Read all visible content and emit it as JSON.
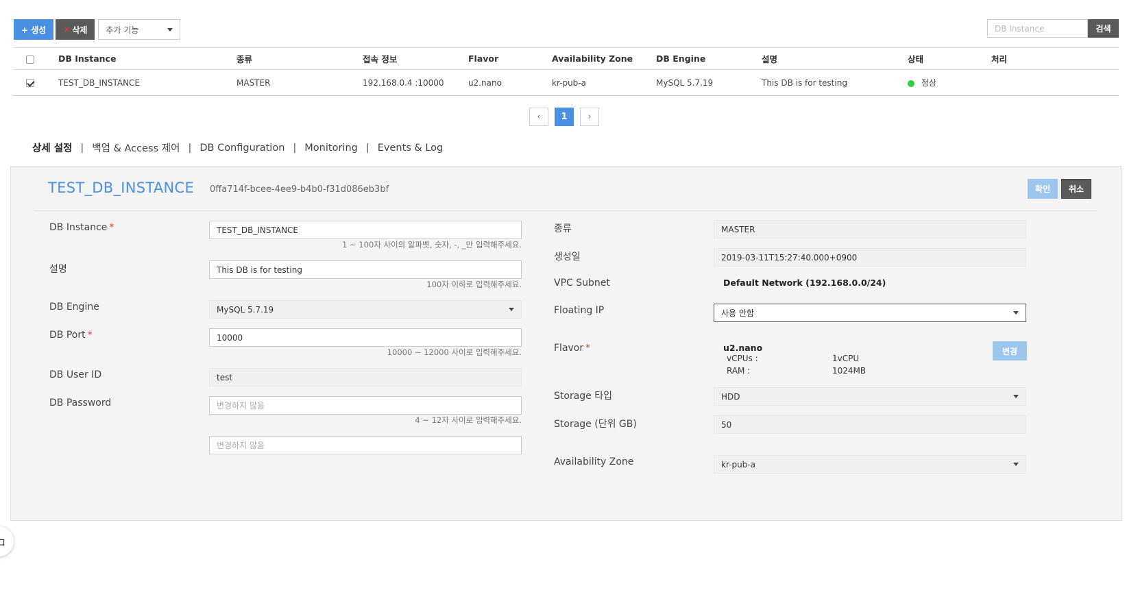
{
  "toolbar": {
    "create_label": "+ 생성",
    "delete_x": "✕",
    "delete_label": "삭제",
    "more_label": "추가 기능"
  },
  "search": {
    "placeholder": "DB Instance",
    "button_label": "검색"
  },
  "table": {
    "headers": [
      "DB Instance",
      "종류",
      "접속 정보",
      "Flavor",
      "Availability Zone",
      "DB Engine",
      "설명",
      "상태",
      "처리"
    ],
    "rows": [
      {
        "checked": true,
        "instance": "TEST_DB_INSTANCE",
        "type": "MASTER",
        "endpoint": "192.168.0.4 :10000",
        "flavor": "u2.nano",
        "zone": "kr-pub-a",
        "engine": "MySQL 5.7.19",
        "description": "This DB is for testing",
        "status": "정상",
        "action": ""
      }
    ]
  },
  "pagination": {
    "prev": "‹",
    "current": "1",
    "next": "›"
  },
  "tabs": [
    "상세 설정",
    "백업 & Access 제어",
    "DB Configuration",
    "Monitoring",
    "Events & Log"
  ],
  "detail": {
    "name": "TEST_DB_INSTANCE",
    "id": "0ffa714f-bcee-4ee9-b4b0-f31d086eb3bf",
    "confirm_label": "확인",
    "cancel_label": "취소",
    "left": {
      "instance_label": "DB Instance",
      "instance_value": "TEST_DB_INSTANCE",
      "instance_hint": "1 ~ 100자 사이의 알파벳, 숫자, -, _만 입력해주세요.",
      "desc_label": "설명",
      "desc_value": "This DB is for testing",
      "desc_hint": "100자 이하로 입력해주세요.",
      "engine_label": "DB Engine",
      "engine_value": "MySQL 5.7.19",
      "port_label": "DB Port",
      "port_value": "10000",
      "port_hint": "10000 ~ 12000 사이로 입력해주세요.",
      "user_label": "DB User ID",
      "user_value": "test",
      "password_label": "DB Password",
      "password_placeholder": "변경하지 않음",
      "password_hint": "4 ~ 12자 사이로 입력해주세요.",
      "password_confirm_placeholder": "변경하지 않음"
    },
    "right": {
      "type_label": "종류",
      "type_value": "MASTER",
      "created_label": "생성일",
      "created_value": "2019-03-11T15:27:40.000+0900",
      "subnet_label": "VPC Subnet",
      "subnet_value": "Default Network (192.168.0.0/24)",
      "floating_label": "Floating IP",
      "floating_value": "사용 안함",
      "flavor_label": "Flavor",
      "flavor_name": "u2.nano",
      "vcpus_label": "vCPUs :",
      "vcpus_value": "1vCPU",
      "ram_label": "RAM :",
      "ram_value": "1024MB",
      "change_label": "변경",
      "storage_type_label": "Storage 타입",
      "storage_type_value": "HDD",
      "storage_size_label": "Storage (단위 GB)",
      "storage_size_value": "50",
      "zone_label": "Availability Zone",
      "zone_value": "kr-pub-a"
    }
  },
  "float_button_label": "ロ",
  "colors": {
    "accent": "#4a90e2",
    "status_ok": "#2ecc40",
    "required": "#e53935"
  }
}
